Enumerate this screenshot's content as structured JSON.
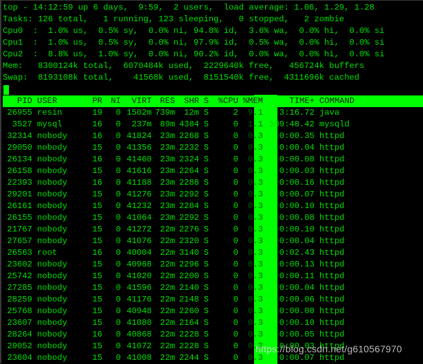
{
  "summary": {
    "uptime_line": "top - 14:12:59 up 6 days,  9:59,  2 users,  load average: 1.06, 1.29, 1.28",
    "tasks_line": "Tasks: 126 total,   1 running, 123 sleeping,   0 stopped,   2 zombie",
    "cpu0_line": "Cpu0  :  1.0% us,  0.5% sy,  0.0% ni, 94.8% id,  3.6% wa,  0.0% hi,  0.0% si",
    "cpu1_line": "Cpu1  :  1.0% us,  0.5% sy,  0.0% ni, 97.9% id,  0.5% wa,  0.0% hi,  0.0% si",
    "cpu2_line": "Cpu2  :  8.8% us,  1.0% sy,  0.0% ni, 90.2% id,  0.0% wa,  0.0% hi,  0.0% si",
    "mem_line": "Mem:   8300124k total,  6070484k used,  2229640k free,   456724k buffers",
    "swap_line": "Swap:  8193108k total,    41568k used,  8151540k free,  4311696k cached"
  },
  "table": {
    "headers": {
      "pid": "PID",
      "user": "USER",
      "pr": "PR",
      "ni": "NI",
      "virt": "VIRT",
      "res": "RES",
      "shr": "SHR",
      "s": "S",
      "cpu": "%CPU",
      "mem": "%MEM",
      "time": "TIME+",
      "command": "COMMAND"
    },
    "rows": [
      {
        "pid": "26955",
        "user": "resin",
        "pr": "19",
        "ni": "0",
        "virt": "1502m",
        "res": "739m",
        "shr": "12m",
        "s": "S",
        "cpu": "2",
        "mem": "9.1",
        "time": "3:16.72",
        "command": "java"
      },
      {
        "pid": "3527",
        "user": "mysql",
        "pr": "16",
        "ni": "0",
        "virt": "237m",
        "res": "89m",
        "shr": "4384",
        "s": "S",
        "cpu": "0",
        "mem": "1.1",
        "time": "509:48.42",
        "command": "mysqld"
      },
      {
        "pid": "32314",
        "user": "nobody",
        "pr": "16",
        "ni": "0",
        "virt": "41824",
        "res": "23m",
        "shr": "2268",
        "s": "S",
        "cpu": "0",
        "mem": "0.3",
        "time": "0:00.35",
        "command": "httpd"
      },
      {
        "pid": "29050",
        "user": "nobody",
        "pr": "15",
        "ni": "0",
        "virt": "41356",
        "res": "23m",
        "shr": "2232",
        "s": "S",
        "cpu": "0",
        "mem": "0.3",
        "time": "0:00.04",
        "command": "httpd"
      },
      {
        "pid": "26134",
        "user": "nobody",
        "pr": "16",
        "ni": "0",
        "virt": "41460",
        "res": "23m",
        "shr": "2324",
        "s": "S",
        "cpu": "0",
        "mem": "0.3",
        "time": "0:00.08",
        "command": "httpd"
      },
      {
        "pid": "26158",
        "user": "nobody",
        "pr": "15",
        "ni": "0",
        "virt": "41616",
        "res": "23m",
        "shr": "2264",
        "s": "S",
        "cpu": "0",
        "mem": "0.3",
        "time": "0:00.03",
        "command": "httpd"
      },
      {
        "pid": "22393",
        "user": "nobody",
        "pr": "16",
        "ni": "0",
        "virt": "41188",
        "res": "23m",
        "shr": "2288",
        "s": "S",
        "cpu": "0",
        "mem": "0.3",
        "time": "0:00.16",
        "command": "httpd"
      },
      {
        "pid": "29201",
        "user": "nobody",
        "pr": "15",
        "ni": "0",
        "virt": "41276",
        "res": "23m",
        "shr": "2292",
        "s": "S",
        "cpu": "0",
        "mem": "0.3",
        "time": "0:00.07",
        "command": "httpd"
      },
      {
        "pid": "26161",
        "user": "nobody",
        "pr": "15",
        "ni": "0",
        "virt": "41232",
        "res": "23m",
        "shr": "2284",
        "s": "S",
        "cpu": "0",
        "mem": "0.3",
        "time": "0:00.10",
        "command": "httpd"
      },
      {
        "pid": "26155",
        "user": "nobody",
        "pr": "15",
        "ni": "0",
        "virt": "41064",
        "res": "23m",
        "shr": "2292",
        "s": "S",
        "cpu": "0",
        "mem": "0.3",
        "time": "0:00.08",
        "command": "httpd"
      },
      {
        "pid": "21767",
        "user": "nobody",
        "pr": "15",
        "ni": "0",
        "virt": "41272",
        "res": "22m",
        "shr": "2276",
        "s": "S",
        "cpu": "0",
        "mem": "0.3",
        "time": "0:00.10",
        "command": "httpd"
      },
      {
        "pid": "27657",
        "user": "nobody",
        "pr": "15",
        "ni": "0",
        "virt": "41076",
        "res": "22m",
        "shr": "2320",
        "s": "S",
        "cpu": "0",
        "mem": "0.3",
        "time": "0:00.04",
        "command": "httpd"
      },
      {
        "pid": "26563",
        "user": "root",
        "pr": "16",
        "ni": "0",
        "virt": "40004",
        "res": "22m",
        "shr": "3140",
        "s": "S",
        "cpu": "0",
        "mem": "0.3",
        "time": "0:02.43",
        "command": "httpd"
      },
      {
        "pid": "23602",
        "user": "nobody",
        "pr": "15",
        "ni": "0",
        "virt": "40968",
        "res": "22m",
        "shr": "2296",
        "s": "S",
        "cpu": "0",
        "mem": "0.3",
        "time": "0:00.13",
        "command": "httpd"
      },
      {
        "pid": "25742",
        "user": "nobody",
        "pr": "15",
        "ni": "0",
        "virt": "41020",
        "res": "22m",
        "shr": "2200",
        "s": "S",
        "cpu": "0",
        "mem": "0.3",
        "time": "0:00.11",
        "command": "httpd"
      },
      {
        "pid": "27285",
        "user": "nobody",
        "pr": "15",
        "ni": "0",
        "virt": "41596",
        "res": "22m",
        "shr": "2140",
        "s": "S",
        "cpu": "0",
        "mem": "0.3",
        "time": "0:00.04",
        "command": "httpd"
      },
      {
        "pid": "28259",
        "user": "nobody",
        "pr": "15",
        "ni": "0",
        "virt": "41176",
        "res": "22m",
        "shr": "2148",
        "s": "S",
        "cpu": "0",
        "mem": "0.3",
        "time": "0:00.06",
        "command": "httpd"
      },
      {
        "pid": "25768",
        "user": "nobody",
        "pr": "15",
        "ni": "0",
        "virt": "40948",
        "res": "22m",
        "shr": "2260",
        "s": "S",
        "cpu": "0",
        "mem": "0.3",
        "time": "0:00.08",
        "command": "httpd"
      },
      {
        "pid": "23607",
        "user": "nobody",
        "pr": "15",
        "ni": "0",
        "virt": "41080",
        "res": "22m",
        "shr": "2164",
        "s": "S",
        "cpu": "0",
        "mem": "0.3",
        "time": "0:00.10",
        "command": "httpd"
      },
      {
        "pid": "28264",
        "user": "nobody",
        "pr": "16",
        "ni": "0",
        "virt": "40868",
        "res": "22m",
        "shr": "2228",
        "s": "S",
        "cpu": "0",
        "mem": "0.3",
        "time": "0:00.05",
        "command": "httpd"
      },
      {
        "pid": "29052",
        "user": "nobody",
        "pr": "15",
        "ni": "0",
        "virt": "41072",
        "res": "22m",
        "shr": "2228",
        "s": "S",
        "cpu": "0",
        "mem": "0.3",
        "time": "0:00.03",
        "command": "httpd"
      },
      {
        "pid": "23604",
        "user": "nobody",
        "pr": "15",
        "ni": "0",
        "virt": "41008",
        "res": "22m",
        "shr": "2244",
        "s": "S",
        "cpu": "0",
        "mem": "0.3",
        "time": "0:00.07",
        "command": "httpd"
      }
    ]
  },
  "watermark": "https://blog.csdn.net/g610567970",
  "colors": {
    "foreground": "#00e000",
    "highlight": "#00ff00",
    "background": "#000000"
  }
}
